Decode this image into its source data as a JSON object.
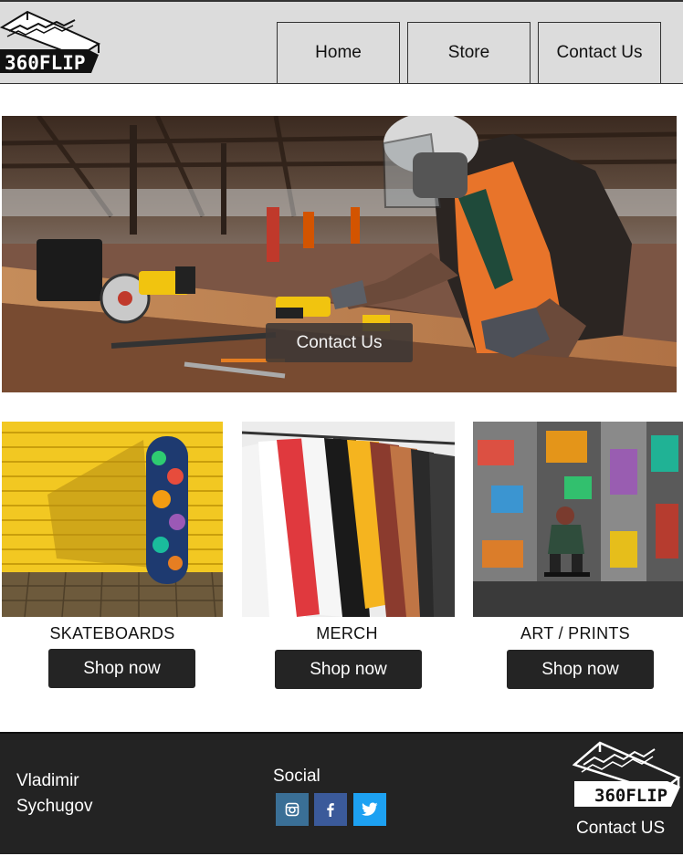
{
  "brand": {
    "logo_text": "360FLIP"
  },
  "nav": {
    "items": [
      {
        "label": "Home"
      },
      {
        "label": "Store"
      },
      {
        "label": "Contact Us"
      }
    ]
  },
  "hero": {
    "button_label": "Contact Us"
  },
  "products": [
    {
      "title": "SKATEBOARDS",
      "button_label": "Shop now"
    },
    {
      "title": "MERCH",
      "button_label": "Shop now"
    },
    {
      "title": "ART / PRINTS",
      "button_label": "Shop now"
    }
  ],
  "footer": {
    "owner_first": "Vladimir",
    "owner_last": "Sychugov",
    "social_label": "Social",
    "social_icons": [
      "instagram-icon",
      "facebook-icon",
      "twitter-icon"
    ],
    "contact_label": "Contact US"
  },
  "colors": {
    "header_bg": "#dcdcdc",
    "button_dark": "#242424",
    "footer_bg": "#232323",
    "instagram": "#3a6f96",
    "facebook": "#3b5a9a",
    "twitter": "#1da1f2"
  }
}
